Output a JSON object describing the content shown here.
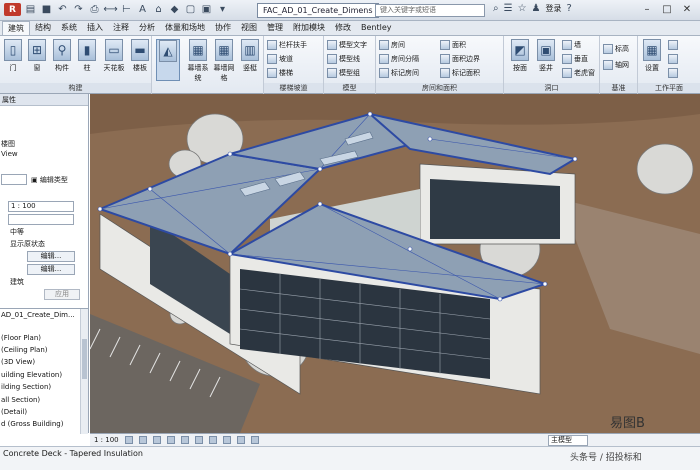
{
  "titlebar": {
    "app_badge": "R",
    "document_title": "FAC_AD_01_Create_Dimens",
    "search_placeholder": "键入关键字或短语",
    "login_label": "登录"
  },
  "tabs": [
    "建筑",
    "结构",
    "系统",
    "插入",
    "注释",
    "分析",
    "体量和场地",
    "协作",
    "视图",
    "管理",
    "附加模块",
    "修改",
    "Bentley"
  ],
  "ribbon": {
    "architecture_buttons": [
      "门",
      "窗",
      "构件",
      "柱",
      "天花板",
      "楼板"
    ],
    "curtain_buttons": [
      "幕墙系统",
      "幕墙网格",
      "竖梃"
    ],
    "stairs_items": [
      "栏杆扶手",
      "坡道",
      "楼梯"
    ],
    "model_items": [
      "模型文字",
      "模型线",
      "模型组"
    ],
    "room_items": [
      "房间",
      "房间分隔",
      "标记房间",
      "面积",
      "面积边界",
      "标记面积"
    ],
    "opening_items": [
      "按面",
      "竖井",
      "墙",
      "垂直",
      "老虎窗"
    ],
    "datum_items": [
      "标高",
      "轴网"
    ],
    "workplane_items": [
      "设置",
      "显示",
      "参照平面",
      "查看器"
    ],
    "panel_titles": [
      "构建",
      "楼梯坡道",
      "模型",
      "房间和面积",
      "洞口",
      "基准",
      "工作平面"
    ],
    "bigbtn_labels": [
      "墙",
      "门",
      "窗",
      "构件",
      "柱",
      "屋顶",
      "天花板",
      "楼板",
      "幕墙系统",
      "幕墙网格",
      "竖梃",
      "洞口",
      "基准",
      "设置"
    ]
  },
  "properties": {
    "header": "属性",
    "type_label_1": "楼图",
    "type_label_2": "View",
    "edit_type_button": "编辑类型",
    "scale_value": "1 : 100",
    "detail_level": "中等",
    "display_model": "显示原状态",
    "edit_button_1": "编辑...",
    "edit_button_2": "编辑...",
    "discipline": "建筑",
    "apply_button": "应用"
  },
  "project_browser": {
    "items": [
      "AD_01_Create_Dim...",
      "(Floor Plan)",
      "(Ceiling Plan)",
      "(3D View)",
      "uilding Elevation)",
      "ilding Section)",
      "all Section)",
      "(Detail)",
      "d (Gross Building)",
      "nd"
    ]
  },
  "view_control_bar": {
    "scale": "1 : 100",
    "main_model": "主模型"
  },
  "status_bar": {
    "text": "Concrete Deck - Tapered Insulation"
  },
  "watermark": {
    "brand": "易图B",
    "source": "头条号 / 招投标和"
  },
  "colors": {
    "ground": "#8b6c52",
    "roof": "#8ea0b4",
    "roof_edge": "#2d4aa3",
    "wall": "#e9e9e6",
    "glass": "#2b3540",
    "accent_green": "#1f8f2a"
  }
}
